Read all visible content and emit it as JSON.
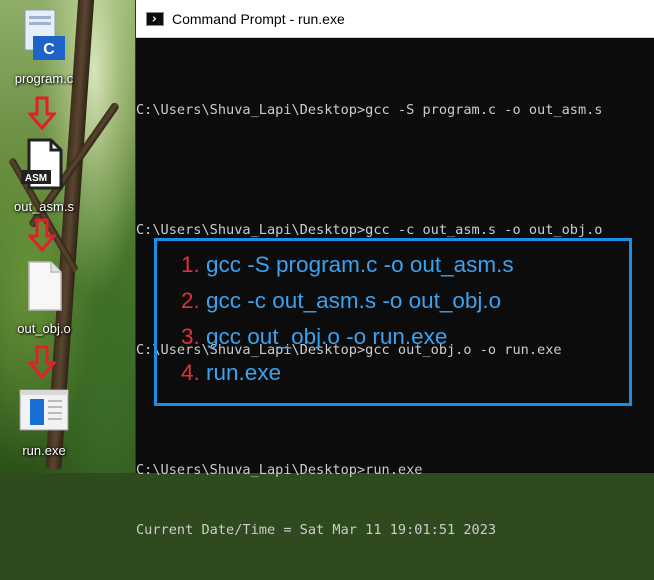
{
  "desktop": {
    "icons": [
      {
        "label": "program.c",
        "glyph": "C",
        "type": "c-file-icon"
      },
      {
        "label": "out_asm.s",
        "glyph": "ASM",
        "type": "asm-file-icon"
      },
      {
        "label": "out_obj.o",
        "type": "blank-file-icon"
      },
      {
        "label": "run.exe",
        "type": "exe-file-icon"
      }
    ]
  },
  "window": {
    "title": "Command Prompt - run.exe"
  },
  "console": {
    "lines": [
      "C:\\Users\\Shuva_Lapi\\Desktop>gcc -S program.c -o out_asm.s",
      "C:\\Users\\Shuva_Lapi\\Desktop>gcc -c out_asm.s -o out_obj.o",
      "C:\\Users\\Shuva_Lapi\\Desktop>gcc out_obj.o -o run.exe",
      "C:\\Users\\Shuva_Lapi\\Desktop>run.exe",
      "Current Date/Time = Sat Mar 11 19:01:51 2023"
    ]
  },
  "summary": {
    "steps": [
      {
        "num": "1.",
        "text": "gcc -S program.c -o out_asm.s"
      },
      {
        "num": "2.",
        "text": "gcc -c out_asm.s -o out_obj.o"
      },
      {
        "num": "3.",
        "text": "gcc out_obj.o -o run.exe"
      },
      {
        "num": "4.",
        "text": "run.exe"
      }
    ]
  },
  "colors": {
    "console_bg": "#0c0c0c",
    "console_text": "#cccccc",
    "step_text": "#3aa2f0",
    "step_number": "#e0323a",
    "box_border": "#1d8fe0",
    "arrow": "#e0202a"
  }
}
